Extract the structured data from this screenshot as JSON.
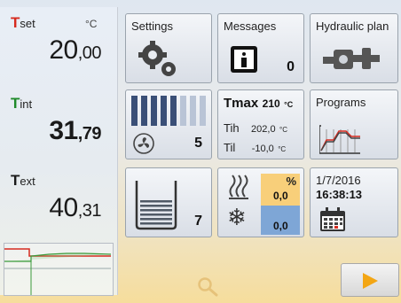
{
  "temperatures": {
    "set": {
      "symbol": "T",
      "sub": "set",
      "unit": "°C",
      "value_int": "20",
      "value_dec": ",00"
    },
    "int": {
      "symbol": "T",
      "sub": "int",
      "value_int": "31",
      "value_dec": ",79"
    },
    "ext": {
      "symbol": "T",
      "sub": "ext",
      "value_int": "40",
      "value_dec": ",31"
    }
  },
  "tiles": {
    "settings": {
      "label": "Settings"
    },
    "messages": {
      "label": "Messages",
      "count": "0"
    },
    "hydraulic": {
      "label": "Hydraulic plan"
    },
    "pump": {
      "level": "5"
    },
    "limits": {
      "tmax_label": "Tmax",
      "tmax_value": "210",
      "tmax_unit": "°C",
      "tih_label": "Tih",
      "tih_value": "202,0",
      "tih_unit": "°C",
      "til_label": "Til",
      "til_value": "-10,0",
      "til_unit": "°C"
    },
    "programs": {
      "label": "Programs"
    },
    "level": {
      "value": "7"
    },
    "heat_cool": {
      "unit": "%",
      "heat_value": "0,0",
      "cool_value": "0,0"
    },
    "datetime": {
      "date": "1/7/2016",
      "time": "16:38:13"
    }
  },
  "colors": {
    "tset": "#d62a1f",
    "tint": "#1f8a2a",
    "text": "#1a1a1a",
    "heat_panel": "#f8cf7a",
    "cool_panel": "#7ea6d6",
    "play_arrow": "#f3a614"
  },
  "icons": {
    "settings": "gears-icon",
    "messages": "info-icon",
    "hydraulic": "pump-valve-icon",
    "pump": "fan-icon",
    "programs": "profile-chart-icon",
    "level": "tank-icon",
    "heat": "heat-waves-icon",
    "cool": "snowflake-icon",
    "calendar": "calendar-icon",
    "search": "magnifier-icon",
    "next": "play-arrow-icon"
  }
}
